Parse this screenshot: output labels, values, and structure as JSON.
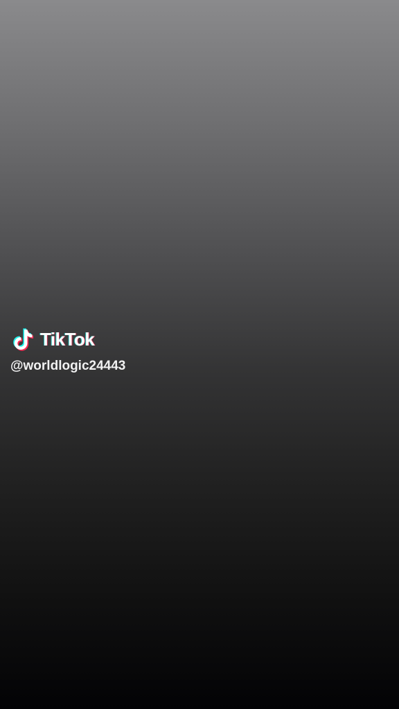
{
  "watermark": {
    "logo_icon": "tiktok-note-icon",
    "brand_name": "TikTok",
    "handle": "@worldlogic24443"
  },
  "colors": {
    "background_top": "#8a8a8c",
    "background_bottom": "#030305",
    "logo_cyan": "#25f4ee",
    "logo_red": "#fe2c55",
    "text": "#ffffff"
  }
}
